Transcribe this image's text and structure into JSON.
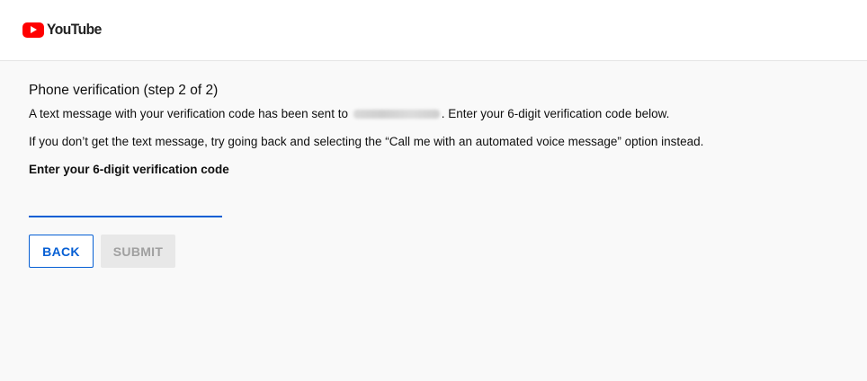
{
  "header": {
    "logo_text": "YouTube"
  },
  "main": {
    "title": "Phone verification (step 2 of 2)",
    "line1_prefix": "A text message with your verification code has been sent to",
    "line1_suffix": ". Enter your 6-digit verification code below.",
    "line2": "If you don’t get the text message, try going back and selecting the “Call me with an automated voice message” option instead.",
    "code_label": "Enter your 6-digit verification code",
    "code_value": ""
  },
  "buttons": {
    "back_label": "BACK",
    "submit_label": "SUBMIT"
  },
  "colors": {
    "accent": "#065fd4",
    "brand": "#ff0000"
  }
}
